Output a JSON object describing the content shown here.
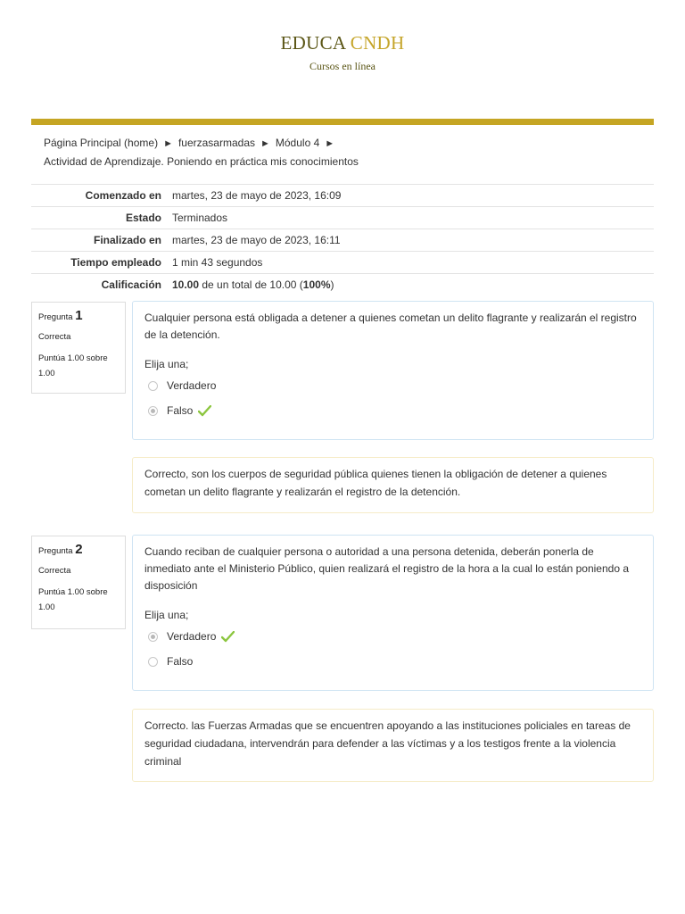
{
  "header": {
    "brand_a": "EDUCA",
    "brand_b": "CNDH",
    "tagline": "Cursos en línea"
  },
  "colors": {
    "gold": "#c5a523",
    "olive": "#5a5515",
    "check": "#8cc63f"
  },
  "breadcrumb": {
    "items": [
      "Página Principal (home)",
      "fuerzasarmadas",
      "Módulo 4",
      "Actividad de Aprendizaje. Poniendo en práctica mis conocimientos"
    ],
    "separator": "►"
  },
  "summary": {
    "rows": [
      {
        "label": "Comenzado en",
        "value": "martes, 23 de mayo de 2023, 16:09"
      },
      {
        "label": "Estado",
        "value": "Terminados"
      },
      {
        "label": "Finalizado en",
        "value": "martes, 23 de mayo de 2023, 16:11"
      },
      {
        "label": "Tiempo empleado",
        "value": "1 min 43 segundos"
      }
    ],
    "grade_label": "Calificación",
    "grade_value": "10.00",
    "grade_mid": " de un total de 10.00 (",
    "grade_pct": "100%",
    "grade_end": ")"
  },
  "questions": [
    {
      "label": "Pregunta",
      "number": "1",
      "state": "Correcta",
      "grade": "Puntúa 1.00 sobre 1.00",
      "text": "Cualquier persona está obligada a detener a quienes cometan un delito flagrante y realizarán el registro de la detención.",
      "prompt": "Elija una;",
      "answers": [
        {
          "label": "Verdadero",
          "selected": false,
          "correct": false
        },
        {
          "label": "Falso",
          "selected": true,
          "correct": true
        }
      ],
      "feedback": "Correcto, son los cuerpos de seguridad pública quienes tienen la obligación de detener a quienes cometan un delito flagrante y realizarán el registro de la detención."
    },
    {
      "label": "Pregunta",
      "number": "2",
      "state": "Correcta",
      "grade": "Puntúa 1.00 sobre 1.00",
      "text": "Cuando reciban de cualquier persona o autoridad a una persona detenida, deberán ponerla de inmediato ante el Ministerio Público, quien realizará el registro de la hora a la cual lo están poniendo a disposición",
      "prompt": "Elija una;",
      "answers": [
        {
          "label": "Verdadero",
          "selected": true,
          "correct": true
        },
        {
          "label": "Falso",
          "selected": false,
          "correct": false
        }
      ],
      "feedback": "Correcto. las Fuerzas Armadas que se encuentren apoyando a las instituciones policiales en tareas de seguridad ciudadana, intervendrán para defender a las víctimas y a los testigos frente a la violencia criminal"
    }
  ]
}
